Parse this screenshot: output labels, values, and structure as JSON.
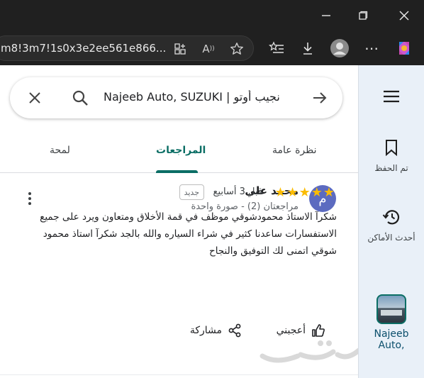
{
  "browser": {
    "url": "m8!3m7!1s0x3e2ee561e866...",
    "window_controls": [
      "minimize-icon",
      "maximize-icon",
      "close-icon"
    ]
  },
  "search": {
    "query": "نجيب أوتو | Najeeb Auto, SUZUKI"
  },
  "tabs": [
    {
      "label": "نظرة عامة",
      "active": false
    },
    {
      "label": "المراجعات",
      "active": true
    },
    {
      "label": "لمحة",
      "active": false
    }
  ],
  "review": {
    "avatar_letter": "م",
    "avatar_color": "#5c6bc0",
    "author": "محمد علي",
    "meta": "مراجعتان (2) - صورة واحدة",
    "stars": 5,
    "time_ago": "قبل 3 أسابيع",
    "badge": "جديد",
    "text": "شكرآ الاستاذ محمودشوقي موظف في قمة الأخلاق ومتعاون ويرد على جميع الاستفسارات ساعدنا كثير في شراء السياره والله بالجد شكرآ استاذ محمود شوقي اتمنى لك التوفيق والنجاح",
    "like_label": "أعجبني",
    "share_label": "مشاركة"
  },
  "sidebar": {
    "saved_label": "تم الحفظ",
    "recent_label": "أحدث الأماكن",
    "place_label_line1": "Najeeb",
    "place_label_line2": "Auto,"
  },
  "accent_color": "#0b6e65",
  "star_color": "#fbbc04"
}
